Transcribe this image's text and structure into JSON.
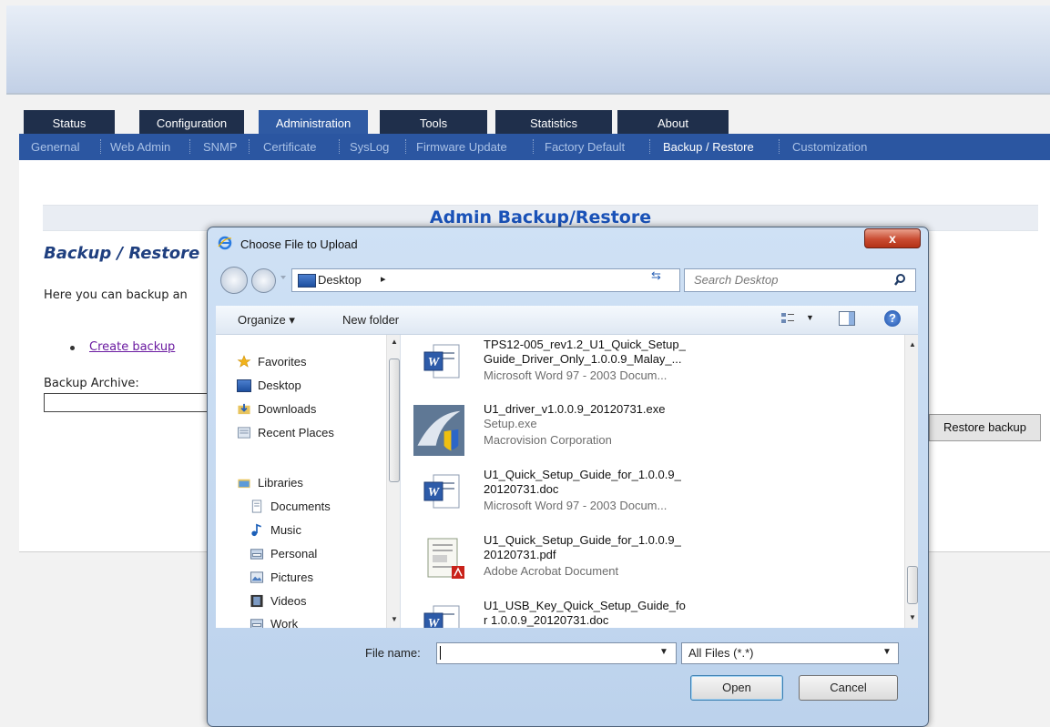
{
  "tabs": [
    "Status",
    "Configuration",
    "Administration",
    "Tools",
    "Statistics",
    "About"
  ],
  "active_tab": "Administration",
  "subnav": [
    "Genernal",
    "Web Admin",
    "SNMP",
    "Certificate",
    "SysLog",
    "Firmware Update",
    "Factory Default",
    "Backup / Restore",
    "Customization"
  ],
  "active_subnav": "Backup / Restore",
  "page": {
    "title": "Admin Backup/Restore",
    "section_title": "Backup / Restore",
    "description": "Here you can backup an",
    "create_backup": "Create backup",
    "archive_label": "Backup Archive:",
    "restore_button": "Restore backup"
  },
  "dialog": {
    "title": "Choose File to Upload",
    "address": "Desktop",
    "search_placeholder": "Search Desktop",
    "organize": "Organize ▾",
    "new_folder": "New folder",
    "nav": [
      {
        "label": "Favorites",
        "icon": "star-icon"
      },
      {
        "label": "Desktop",
        "icon": "desktop-icon"
      },
      {
        "label": "Downloads",
        "icon": "downloads-icon"
      },
      {
        "label": "Recent Places",
        "icon": "recent-places-icon"
      },
      {
        "label": "Libraries",
        "icon": "libraries-icon"
      },
      {
        "label": "Documents",
        "icon": "documents-icon"
      },
      {
        "label": "Music",
        "icon": "music-icon"
      },
      {
        "label": "Personal",
        "icon": "folder-icon"
      },
      {
        "label": "Pictures",
        "icon": "pictures-icon"
      },
      {
        "label": "Videos",
        "icon": "videos-icon"
      },
      {
        "label": "Work",
        "icon": "folder-icon"
      }
    ],
    "files": [
      {
        "name1": "TPS12-005_rev1.2_U1_Quick_Setup_",
        "name2": "Guide_Driver_Only_1.0.0.9_Malay_...",
        "type": "Microsoft Word 97 - 2003 Docum...",
        "icon": "word-doc-icon"
      },
      {
        "name1": "U1_driver_v1.0.0.9_20120731.exe",
        "name2": "Setup.exe",
        "type": "Macrovision Corporation",
        "icon": "setup-exe-icon"
      },
      {
        "name1": "U1_Quick_Setup_Guide_for_1.0.0.9_",
        "name2": "20120731.doc",
        "type": "Microsoft Word 97 - 2003 Docum...",
        "icon": "word-doc-icon"
      },
      {
        "name1": "U1_Quick_Setup_Guide_for_1.0.0.9_",
        "name2": "20120731.pdf",
        "type": "Adobe Acrobat Document",
        "icon": "pdf-icon"
      },
      {
        "name1": "U1_USB_Key_Quick_Setup_Guide_fo",
        "name2": "r 1.0.0.9_20120731.doc",
        "type": "",
        "icon": "word-doc-icon"
      }
    ],
    "file_name_label": "File name:",
    "file_name_value": "",
    "filter": "All Files (*.*)",
    "open_button": "Open",
    "cancel_button": "Cancel",
    "close_glyph": "x"
  }
}
